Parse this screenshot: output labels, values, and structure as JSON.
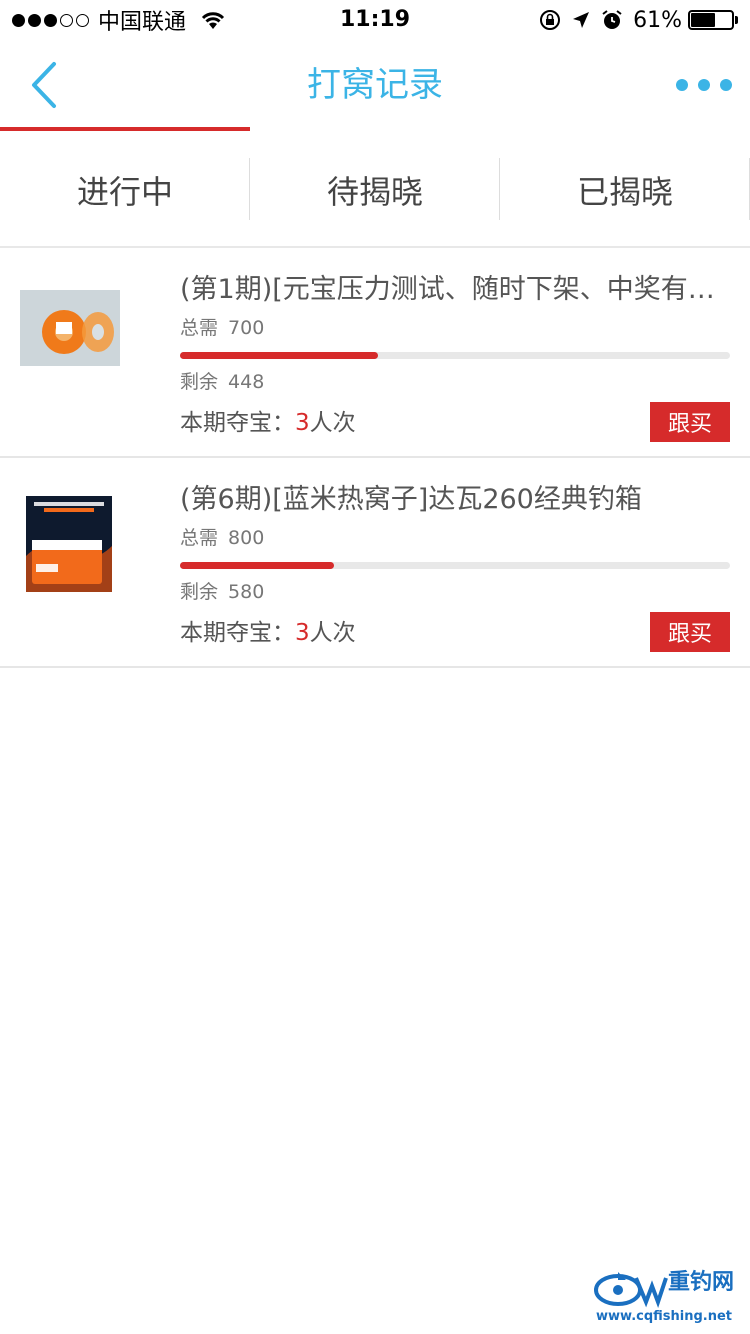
{
  "status_bar": {
    "carrier": "中国联通",
    "time": "11:19",
    "battery_pct": "61%",
    "battery_level": 0.61,
    "signal_filled": 3,
    "signal_total": 5
  },
  "nav": {
    "title": "打窝记录",
    "back_icon": "chevron-left-icon",
    "more_icon": "more-dots-icon",
    "accent_color": "#3bb4e6"
  },
  "tabs": [
    {
      "label": "进行中",
      "active": true
    },
    {
      "label": "待揭晓",
      "active": false
    },
    {
      "label": "已揭晓",
      "active": false
    }
  ],
  "items": [
    {
      "title": "(第1期)[元宝压力测试、随时下架、中奖有…",
      "need_label": "总需",
      "need": "700",
      "remain_label": "剩余",
      "remain": "448",
      "progress": 0.36,
      "period_label": "本期夺宝：",
      "period_count": "3",
      "period_unit": "人次",
      "button": "跟买"
    },
    {
      "title": "(第6期)[蓝米热窝子]达瓦260经典钓箱",
      "need_label": "总需",
      "need": "800",
      "remain_label": "剩余",
      "remain": "580",
      "progress": 0.28,
      "period_label": "本期夺宝：",
      "period_count": "3",
      "period_unit": "人次",
      "button": "跟买"
    }
  ],
  "watermark": {
    "name": "重钓网",
    "url": "www.cqfishing.net"
  },
  "colors": {
    "accent_red": "#d62b2b",
    "accent_blue": "#3bb4e6"
  }
}
